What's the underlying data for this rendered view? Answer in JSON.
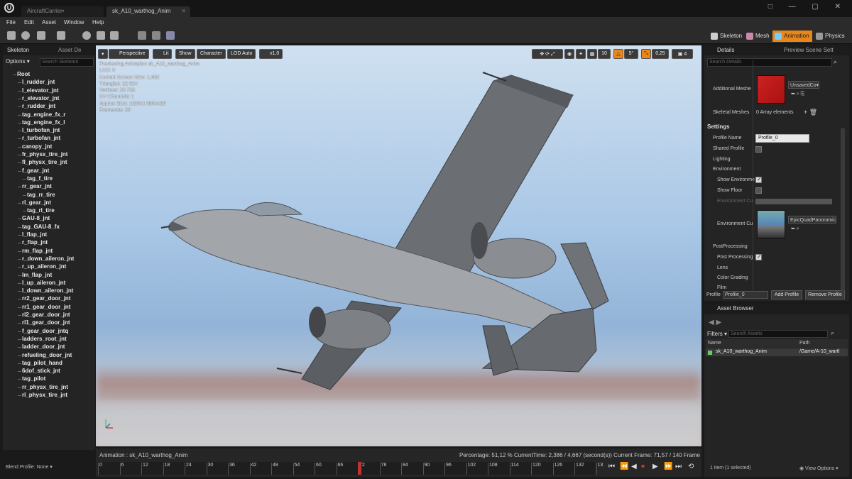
{
  "window": {
    "tabs": [
      "AircraftCarrier•",
      "sk_A10_warthog_Anim"
    ],
    "controls": "□ — ▢ ✕"
  },
  "menu": [
    "File",
    "Edit",
    "Asset",
    "Window",
    "Help"
  ],
  "modes": [
    "Skeleton",
    "Mesh",
    "Animation",
    "Physics"
  ],
  "skeleton_panel": {
    "tabs": [
      "Skeleton",
      "Asset De"
    ],
    "options": "Options ▾",
    "search_placeholder": "Search Skeleton",
    "bones": [
      "Root",
      "l_rudder_jnt",
      "l_elevator_jnt",
      "r_elevator_jnt",
      "r_rudder_jnt",
      "tag_engine_fx_r",
      "tag_engine_fx_l",
      "l_turbofan_jnt",
      "r_turbofan_jnt",
      "canopy_jnt",
      "fr_physx_tire_jnt",
      "fl_physx_tire_jnt",
      "f_gear_jnt",
      "tag_f_tire",
      "rr_gear_jnt",
      "tag_rr_tire",
      "rl_gear_jnt",
      "tag_rl_tire",
      "GAU-8_jnt",
      "tag_GAU-8_fx",
      "l_flap_jnt",
      "r_flap_jnt",
      "rm_flap_jnt",
      "r_down_aileron_jnt",
      "r_up_aileron_jnt",
      "lm_flap_jnt",
      "l_up_aileron_jnt",
      "l_down_aileron_jnt",
      "rr2_gear_door_jnt",
      "rr1_gear_door_jnt",
      "rl2_gear_door_jnt",
      "rl1_gear_door_jnt",
      "f_gear_door_jntq",
      "ladders_root_jnt",
      "ladder_door_jnt",
      "refueling_door_jnt",
      "tag_pilot_hand",
      "6dof_stick_jnt",
      "tag_pilot",
      "rr_physx_tire_jnt",
      "rl_physx_tire_jnt"
    ],
    "blend_profile": "Blend Profile: None ▾"
  },
  "viewport": {
    "buttons": [
      "▾",
      "Perspective",
      "Lit",
      "Show",
      "Character",
      "LOD Auto",
      "x1,0"
    ],
    "info": [
      "Previewing Animation sk_A10_warthog_Anim",
      "LOD: 0",
      "Current Screen Size: 1,662",
      "Triangles: 22 824",
      "Vertices: 23 733",
      "UV Channels: 1",
      "Approx Size: 1626x1 885x428",
      "Framerate: 30"
    ],
    "right_tools": [
      "10",
      "5°",
      "0,25",
      "4"
    ]
  },
  "timeline": {
    "animation": "Animation : sk_A10_warthog_Anim",
    "stats": "Percentage: 51,12 % CurrentTime: 2,386 / 4,667 (second(s)) Current Frame: 71,57 / 140 Frame",
    "ticks": [
      "0",
      "6",
      "12",
      "18",
      "24",
      "30",
      "36",
      "42",
      "48",
      "54",
      "60",
      "66",
      "72",
      "78",
      "84",
      "90",
      "96",
      "102",
      "108",
      "114",
      "120",
      "126",
      "132",
      "13"
    ],
    "current_frame_fraction": 0.5112
  },
  "details": {
    "tabs": [
      "Details",
      "Preview Scene Sett"
    ],
    "search_placeholder": "Search Details",
    "additional_meshes_label": "Additional Meshe",
    "additional_meshes_value": "UnsavedCo▾",
    "skeletal_meshes_label": "Skeletal Meshes",
    "skeletal_meshes_value": "0 Array elements",
    "settings": "Settings",
    "profile_name_label": "Profile Name",
    "profile_name_value": "Profile_0",
    "shared_profile": "Shared Profile",
    "lighting": "Lighting",
    "environment": "Environment",
    "show_environment": "Show Environme",
    "show_floor": "Show Floor",
    "environment_cube": "Environment Cu",
    "environment_cube2": "Environment Cu",
    "cubemap_value": "EpicQuadPanoramic▾",
    "postprocessing": "PostProcessing",
    "postprocessing_enabled": "Post Processing",
    "lens": "Lens",
    "color_grading": "Color Grading",
    "film": "Film",
    "profile_label": "Profile",
    "profile_drop": "Profile_0",
    "add_profile": "Add Profile",
    "remove_profile": "Remove Profile"
  },
  "asset_browser": {
    "title": "Asset Browser",
    "filters": "Filters ▾",
    "search_placeholder": "Search Assets",
    "col_name": "Name",
    "col_path": "Path",
    "row_name": "sk_A10_warthog_Anim",
    "row_path": "/Game/A-10_wartl",
    "status": "1 item (1 selected)",
    "view_options": "◉ View Options ▾"
  },
  "colors": {
    "accent": "#e8861a",
    "playhead": "#bb3333",
    "sky": "#a9c7e6"
  }
}
